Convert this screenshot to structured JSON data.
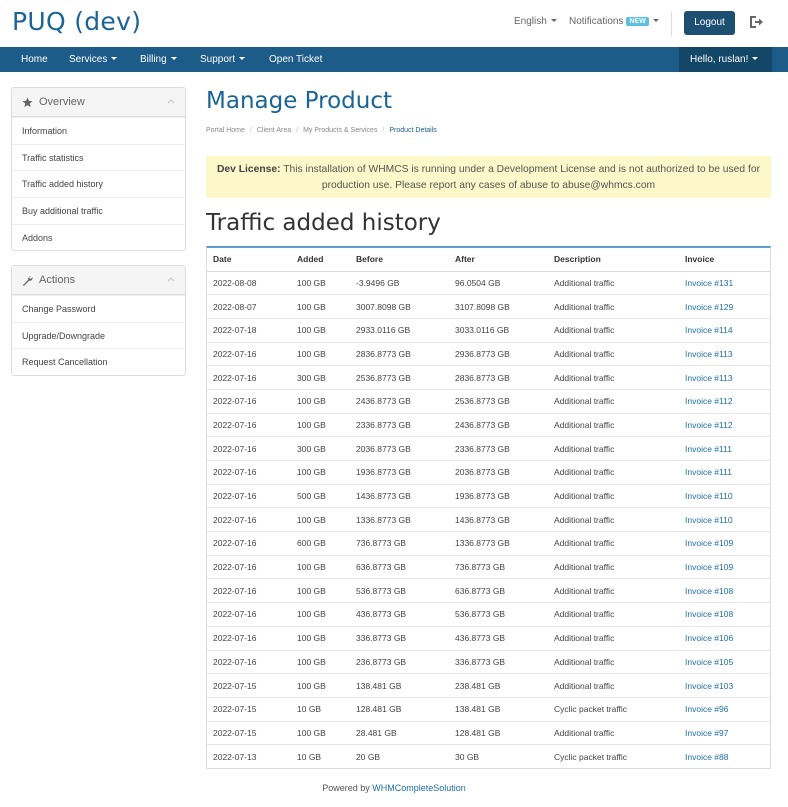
{
  "header": {
    "brand": "PUQ (dev)",
    "language": "English",
    "notifications": "Notifications",
    "notifications_badge": "NEW",
    "logout": "Logout"
  },
  "nav": {
    "items": [
      "Home",
      "Services",
      "Billing",
      "Support",
      "Open Ticket"
    ],
    "user": "Hello, ruslan!"
  },
  "sidebar": {
    "overview": {
      "title": "Overview",
      "items": [
        "Information",
        "Traffic statistics",
        "Traffic added history",
        "Buy additional traffic",
        "Addons"
      ]
    },
    "actions": {
      "title": "Actions",
      "items": [
        "Change Password",
        "Upgrade/Downgrade",
        "Request Cancellation"
      ]
    }
  },
  "main": {
    "title": "Manage Product",
    "breadcrumb": [
      "Portal Home",
      "Client Area",
      "My Products & Services",
      "Product Details"
    ],
    "alert_bold": "Dev License:",
    "alert_text": "This installation of WHMCS is running under a Development License and is not authorized to be used for production use. Please report any cases of abuse to abuse@whmcs.com",
    "section_title": "Traffic added history",
    "table": {
      "headers": [
        "Date",
        "Added",
        "Before",
        "After",
        "Description",
        "Invoice"
      ],
      "rows": [
        [
          "2022-08-08",
          "100 GB",
          "-3.9496 GB",
          "96.0504 GB",
          "Additional traffic",
          "Invoice #131"
        ],
        [
          "2022-08-07",
          "100 GB",
          "3007.8098 GB",
          "3107.8098 GB",
          "Additional traffic",
          "Invoice #129"
        ],
        [
          "2022-07-18",
          "100 GB",
          "2933.0116 GB",
          "3033.0116 GB",
          "Additional traffic",
          "Invoice #114"
        ],
        [
          "2022-07-16",
          "100 GB",
          "2836.8773 GB",
          "2936.8773 GB",
          "Additional traffic",
          "Invoice #113"
        ],
        [
          "2022-07-16",
          "300 GB",
          "2536.8773 GB",
          "2836.8773 GB",
          "Additional traffic",
          "Invoice #113"
        ],
        [
          "2022-07-16",
          "100 GB",
          "2436.8773 GB",
          "2536.8773 GB",
          "Additional traffic",
          "Invoice #112"
        ],
        [
          "2022-07-16",
          "100 GB",
          "2336.8773 GB",
          "2436.8773 GB",
          "Additional traffic",
          "Invoice #112"
        ],
        [
          "2022-07-16",
          "300 GB",
          "2036.8773 GB",
          "2336.8773 GB",
          "Additional traffic",
          "Invoice #111"
        ],
        [
          "2022-07-16",
          "100 GB",
          "1936.8773 GB",
          "2036.8773 GB",
          "Additional traffic",
          "Invoice #111"
        ],
        [
          "2022-07-16",
          "500 GB",
          "1436.8773 GB",
          "1936.8773 GB",
          "Additional traffic",
          "Invoice #110"
        ],
        [
          "2022-07-16",
          "100 GB",
          "1336.8773 GB",
          "1436.8773 GB",
          "Additional traffic",
          "Invoice #110"
        ],
        [
          "2022-07-16",
          "600 GB",
          "736.8773 GB",
          "1336.8773 GB",
          "Additional traffic",
          "Invoice #109"
        ],
        [
          "2022-07-16",
          "100 GB",
          "636.8773 GB",
          "736.8773 GB",
          "Additional traffic",
          "Invoice #109"
        ],
        [
          "2022-07-16",
          "100 GB",
          "536.8773 GB",
          "636.8773 GB",
          "Additional traffic",
          "Invoice #108"
        ],
        [
          "2022-07-16",
          "100 GB",
          "436.8773 GB",
          "536.8773 GB",
          "Additional traffic",
          "Invoice #108"
        ],
        [
          "2022-07-16",
          "100 GB",
          "336.8773 GB",
          "436.8773 GB",
          "Additional traffic",
          "Invoice #106"
        ],
        [
          "2022-07-16",
          "100 GB",
          "236.8773 GB",
          "336.8773 GB",
          "Additional traffic",
          "Invoice #105"
        ],
        [
          "2022-07-15",
          "100 GB",
          "138.481 GB",
          "238.481 GB",
          "Additional traffic",
          "Invoice #103"
        ],
        [
          "2022-07-15",
          "10 GB",
          "128.481 GB",
          "138.481 GB",
          "Cyclic packet traffic",
          "Invoice #96"
        ],
        [
          "2022-07-15",
          "100 GB",
          "28.481 GB",
          "128.481 GB",
          "Additional traffic",
          "Invoice #97"
        ],
        [
          "2022-07-13",
          "10 GB",
          "20 GB",
          "30 GB",
          "Cyclic packet traffic",
          "Invoice #88"
        ]
      ]
    }
  },
  "footer": {
    "prefix": "Powered by",
    "link": "WHMCompleteSolution"
  },
  "colors": {
    "brand": "#1a6496",
    "navbar": "#1d5c89",
    "alert_bg": "#fcf8c9",
    "link": "#1d6fa5"
  }
}
